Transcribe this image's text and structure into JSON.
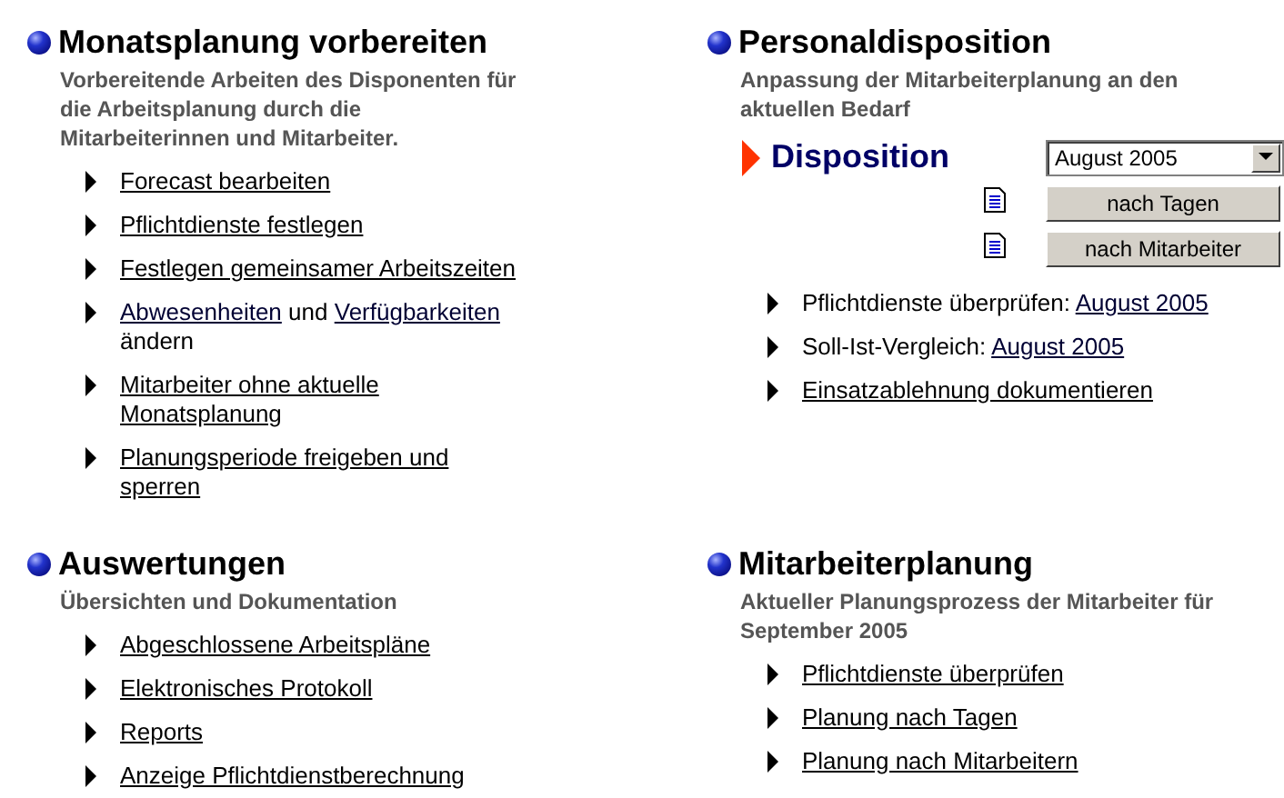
{
  "sections": [
    {
      "title": "Monatsplanung vorbereiten",
      "subtitle": "Vorbereitende Arbeiten des Disponenten für die Arbeitsplanung durch die Mitarbeiterinnen und Mitarbeiter.",
      "items": [
        {
          "parts": [
            {
              "text": "Forecast bearbeiten",
              "link": true
            }
          ]
        },
        {
          "parts": [
            {
              "text": "Pflichtdienste festlegen",
              "link": true
            }
          ]
        },
        {
          "parts": [
            {
              "text": "Festlegen gemeinsamer Arbeitszeiten",
              "link": true
            }
          ]
        },
        {
          "parts": [
            {
              "text": "Abwesenheiten",
              "link": true
            },
            {
              "text": "und",
              "link": false
            },
            {
              "text": "Verfügbarkeiten",
              "link": true
            },
            {
              "text": "ändern",
              "link": false
            }
          ]
        },
        {
          "parts": [
            {
              "text": "Mitarbeiter ohne aktuelle Monatsplanung",
              "link": true
            }
          ]
        },
        {
          "parts": [
            {
              "text": "Planungsperiode freigeben und sperren",
              "link": true
            }
          ]
        }
      ]
    },
    {
      "title": "Personaldisposition",
      "subtitle": "Anpassung der Mitarbeiterplanung an den aktuellen Bedarf",
      "disposition": {
        "label": "Disposition",
        "select": {
          "value": "August 2005"
        },
        "buttons": [
          "nach Tagen",
          "nach Mitarbeiter"
        ]
      },
      "items": [
        {
          "parts": [
            {
              "text": "Pflichtdienste überprüfen:",
              "link": false
            },
            {
              "text": "August 2005",
              "link": true
            }
          ]
        },
        {
          "parts": [
            {
              "text": "Soll-Ist-Vergleich:",
              "link": false
            },
            {
              "text": "August 2005",
              "link": true
            }
          ]
        },
        {
          "parts": [
            {
              "text": "Einsatzablehnung dokumentieren",
              "link": true
            }
          ]
        }
      ]
    },
    {
      "title": "Auswertungen",
      "subtitle": "Übersichten und Dokumentation",
      "items": [
        {
          "parts": [
            {
              "text": "Abgeschlossene Arbeitspläne",
              "link": true
            }
          ]
        },
        {
          "parts": [
            {
              "text": "Elektronisches Protokoll",
              "link": true
            }
          ]
        },
        {
          "parts": [
            {
              "text": "Reports",
              "link": true
            }
          ]
        },
        {
          "parts": [
            {
              "text": "Anzeige Pflichtdienstberechnung",
              "link": true
            }
          ]
        }
      ]
    },
    {
      "title": "Mitarbeiterplanung",
      "subtitle": "Aktueller Planungsprozess der Mitarbeiter für September 2005",
      "items": [
        {
          "parts": [
            {
              "text": "Pflichtdienste überprüfen",
              "link": true
            }
          ]
        },
        {
          "parts": [
            {
              "text": "Planung nach Tagen",
              "link": true
            }
          ]
        },
        {
          "parts": [
            {
              "text": "Planung nach Mitarbeitern",
              "link": true
            }
          ]
        }
      ]
    }
  ]
}
